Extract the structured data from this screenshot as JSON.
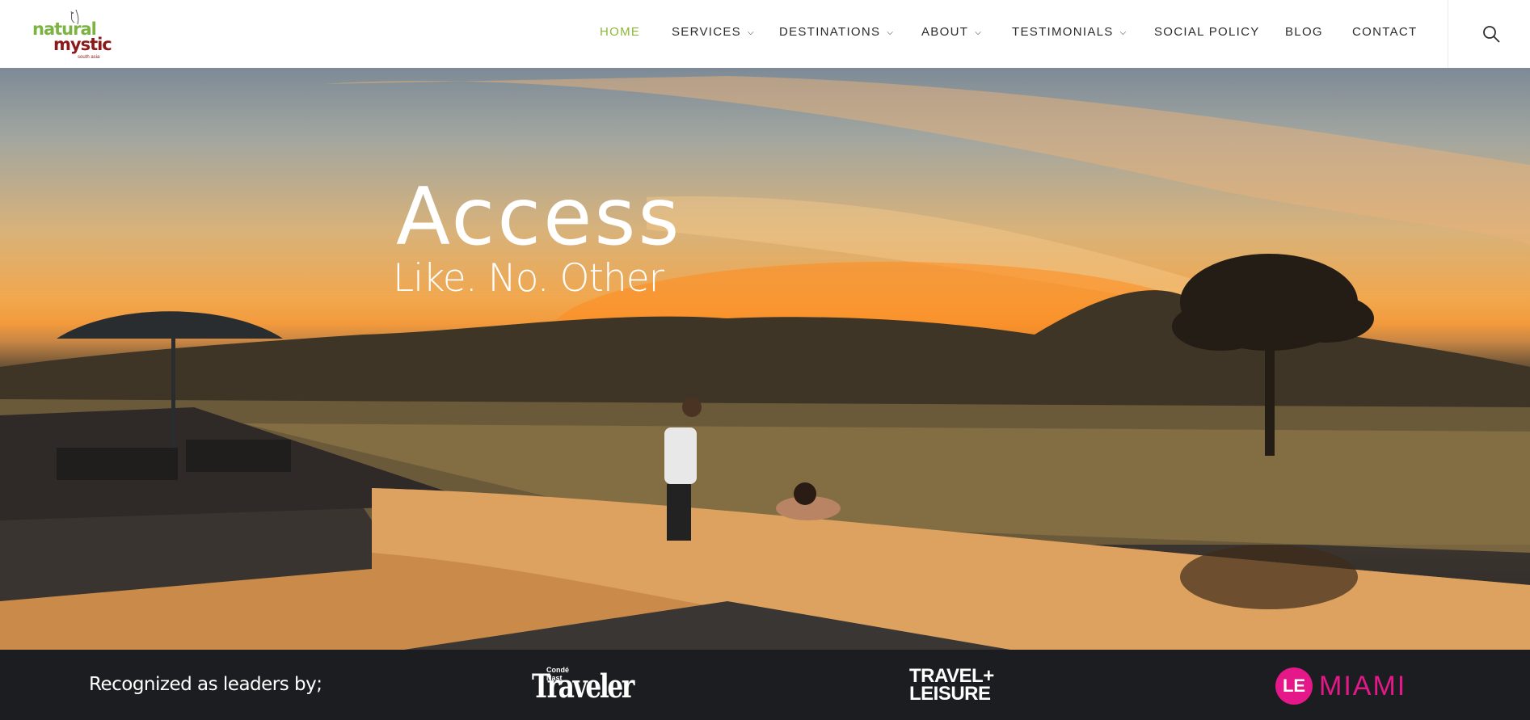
{
  "header": {
    "logo": {
      "line1": "natural",
      "line2": "mystic",
      "line3": "south asia"
    },
    "nav": [
      {
        "label": "HOME",
        "active": true,
        "dropdown": false
      },
      {
        "label": "SERVICES",
        "active": false,
        "dropdown": true
      },
      {
        "label": "DESTINATIONS",
        "active": false,
        "dropdown": true
      },
      {
        "label": "ABOUT",
        "active": false,
        "dropdown": true
      },
      {
        "label": "TESTIMONIALS",
        "active": false,
        "dropdown": true
      },
      {
        "label": "SOCIAL POLICY",
        "active": false,
        "dropdown": false
      },
      {
        "label": "BLOG",
        "active": false,
        "dropdown": false
      },
      {
        "label": "CONTACT",
        "active": false,
        "dropdown": false
      }
    ],
    "search_icon": "search-icon",
    "active_color": "#8cb83a"
  },
  "hero": {
    "title": "Access",
    "subtitle": "Like. No. Other"
  },
  "recognition": {
    "label": "Recognized as leaders by;",
    "logos": {
      "conde_nast_small": "Condé Nast",
      "traveler": "Traveler",
      "travel_leisure_1": "TRAVEL+",
      "travel_leisure_2": "LEISURE",
      "le_mark": "LE",
      "miami": "MIAMI"
    },
    "band_color": "#1c1d20",
    "accent_pink": "#e5188a"
  }
}
